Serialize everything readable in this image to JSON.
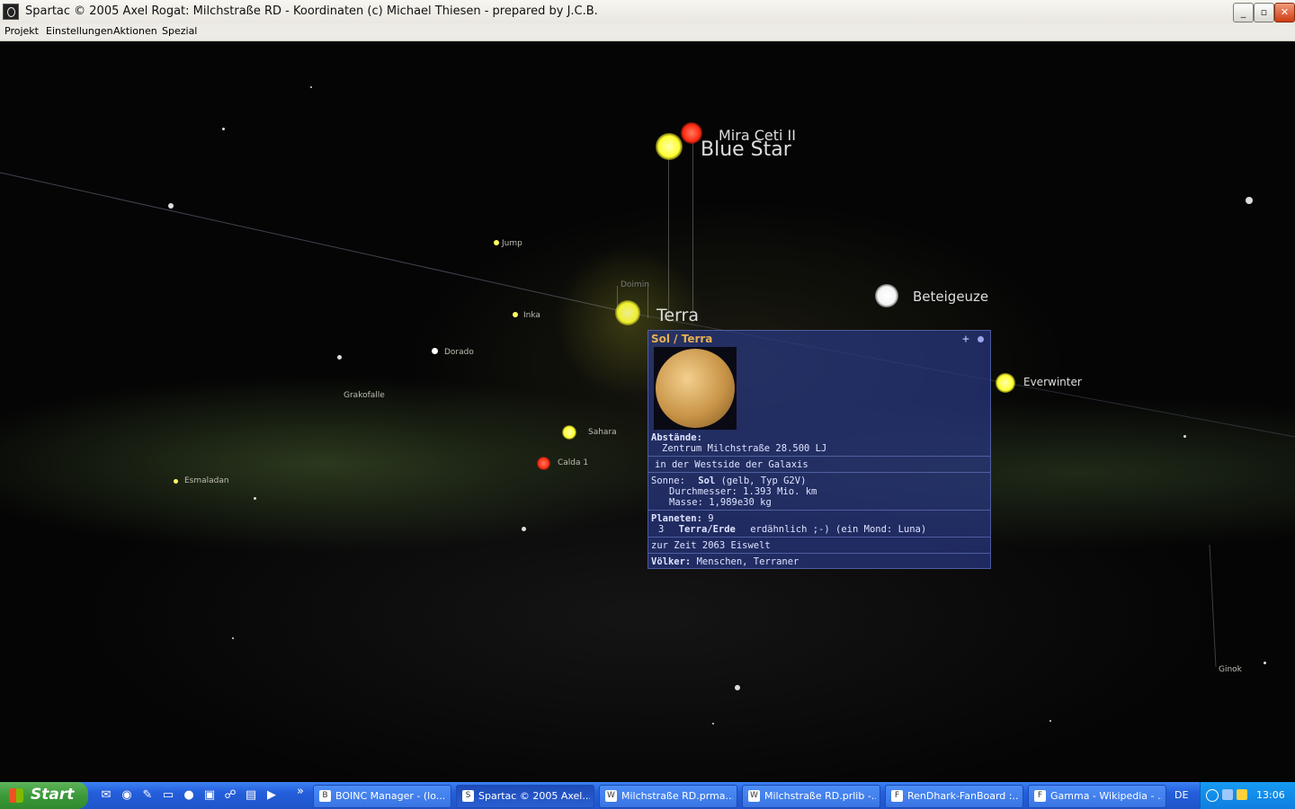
{
  "window": {
    "title": "Spartac © 2005 Axel Rogat:  Milchstraße RD  -  Koordinaten (c) Michael Thiesen - prepared by J.C.B.",
    "min_label": "_",
    "max_label": "▫",
    "close_label": "✕"
  },
  "menu": {
    "items": [
      "Projekt",
      "Einstellungen",
      "Aktionen",
      "Spezial"
    ]
  },
  "map": {
    "labels": {
      "mira": "Mira Ceti II",
      "blue_star": "Blue Star",
      "terra": "Terra",
      "beteigeuze": "Beteigeuze",
      "everwinter": "Everwinter",
      "jump": "Jump",
      "inka": "Inka",
      "doimin": "Doimin",
      "dorado": "Dorado",
      "grakofalle": "Grakofalle",
      "sahara": "Sahara",
      "calda": "Calda 1",
      "esmaladan": "Esmaladan",
      "ginok": "Ginok"
    }
  },
  "info": {
    "title": "Sol / Terra",
    "pin_icon": "+",
    "distances_heading": "Abstände:",
    "distances_center": "Zentrum Milchstraße   28.500 LJ",
    "distances_side": "in der Westside der Galaxis",
    "sun_label": "Sonne:",
    "sun_name": "Sol",
    "sun_type": "(gelb, Typ G2V)",
    "diameter": "Durchmesser:   1.393 Mio. km",
    "mass": "Masse:         1,989e30 kg",
    "planets_heading": "Planeten:",
    "planets_count": "9",
    "planet_index": "3",
    "planet_name": "Terra/Erde",
    "planet_desc": "erdähnlich ;-)   (ein Mond: Luna)",
    "era": "zur Zeit 2063 Eiswelt",
    "peoples_heading": "Völker:",
    "peoples": "Menschen, Terraner"
  },
  "taskbar": {
    "start_label": "Start",
    "quicklaunch": [
      "outlook-icon",
      "firefox-icon",
      "word-icon",
      "folder-icon",
      "globe-icon",
      "winrar-icon",
      "network-icon",
      "document-icon",
      "media-icon"
    ],
    "more": "»",
    "tasks": [
      {
        "label": "BOINC Manager - (lo..."
      },
      {
        "label": "Spartac © 2005 Axel..."
      },
      {
        "label": "Milchstraße RD.prma..."
      },
      {
        "label": "Milchstraße RD.prlib -..."
      },
      {
        "label": "RenDhark-FanBoard :..."
      },
      {
        "label": "Gamma - Wikipedia - ..."
      }
    ],
    "language": "DE",
    "clock": "13:06"
  },
  "colors": {
    "yellow_star": "#ffff40",
    "red_star": "#ff2a10",
    "white_star": "#ffffff",
    "panel": "#28378a",
    "taskbar": "#245edb"
  }
}
